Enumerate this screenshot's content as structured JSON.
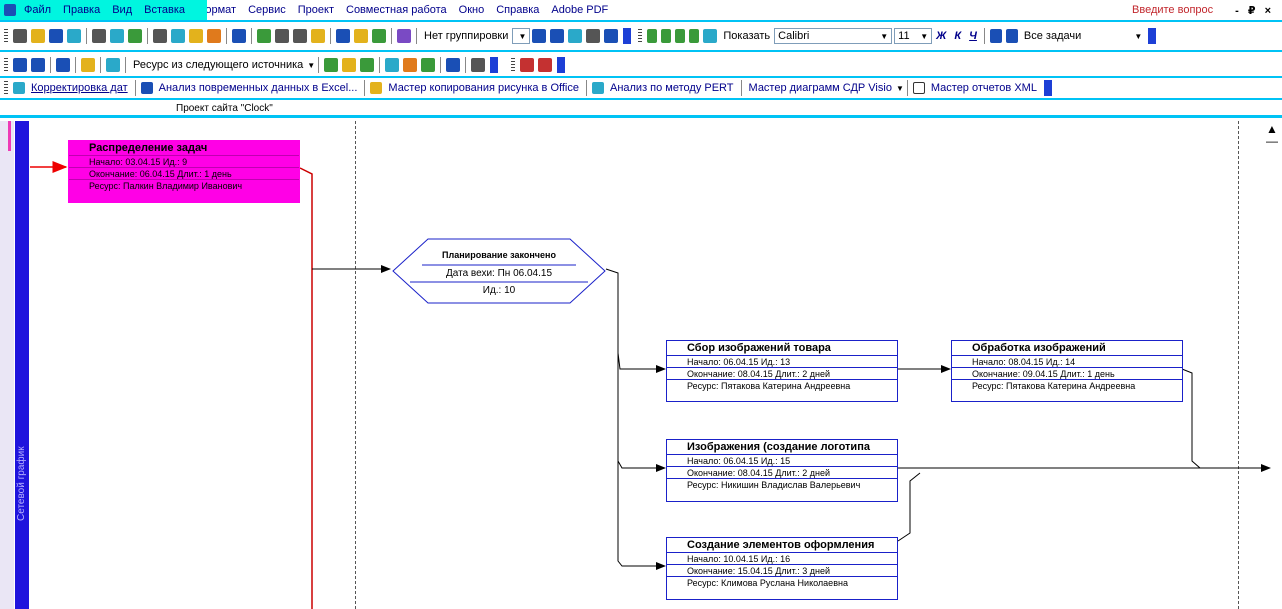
{
  "menu": {
    "items": [
      "Файл",
      "Правка",
      "Вид",
      "Вставка",
      "Формат",
      "Сервис",
      "Проект",
      "Совместная работа",
      "Окно",
      "Справка",
      "Adobe PDF"
    ],
    "ask_placeholder": "Введите вопрос",
    "window_controls": "- ₽ ×"
  },
  "toolbar1": {
    "grouping": "Нет группировки",
    "show": "Показать",
    "font": "Calibri",
    "size": "11",
    "bold": "Ж",
    "italic": "К",
    "underline": "Ч",
    "tasks": "Все задачи"
  },
  "toolbar2": {
    "resource_source": "Ресурс из следующего источника"
  },
  "toolbar3": {
    "items": [
      "Корректировка дат",
      "Анализ повременных данных в Excel...",
      "Мастер копирования рисунка в Office",
      "Анализ по методу PERT",
      "Мастер диаграмм СДР Visio",
      "Мастер отчетов XML"
    ]
  },
  "project_title": "Проект сайта \"Clock\"",
  "left_label": "Сетевой график",
  "nodes": [
    {
      "title": "Распределение задач",
      "start": "Начало:    03.04.15 Ид.:    9",
      "finish": "Окончание: 06.04.15 Длит.: 1 день",
      "resource": "Ресурс:    Палкин Владимир Иванович"
    },
    {
      "title": "Сбор изображений товара",
      "start": "Начало:      06.04.15 Ид.:     13",
      "finish": "Окончание: 08.04.15 Длит.: 2 дней",
      "resource": "Ресурс:    Пятакова Катерина Андреевна"
    },
    {
      "title": "Обработка изображений",
      "start": "Начало:      08.04.15 Ид.:     14",
      "finish": "Окончание: 09.04.15 Длит.: 1 день",
      "resource": "Ресурс:    Пятакова Катерина Андреевна"
    },
    {
      "title": "Изображения (создание логотипа",
      "start": "Начало:      06.04.15 Ид.:     15",
      "finish": "Окончание: 08.04.15 Длит.: 2 дней",
      "resource": "Ресурс:    Никишин Владислав Валерьевич"
    },
    {
      "title": "Создание элементов оформления",
      "start": "Начало:      10.04.15 Ид.:     16",
      "finish": "Окончание: 15.04.15 Длит.: 3 дней",
      "resource": "Ресурс:    Климова Руслана Николаевна"
    }
  ],
  "milestone": {
    "title": "Планирование закончено",
    "date": "Дата вехи: Пн 06.04.15",
    "id": "Ид.: 10"
  }
}
